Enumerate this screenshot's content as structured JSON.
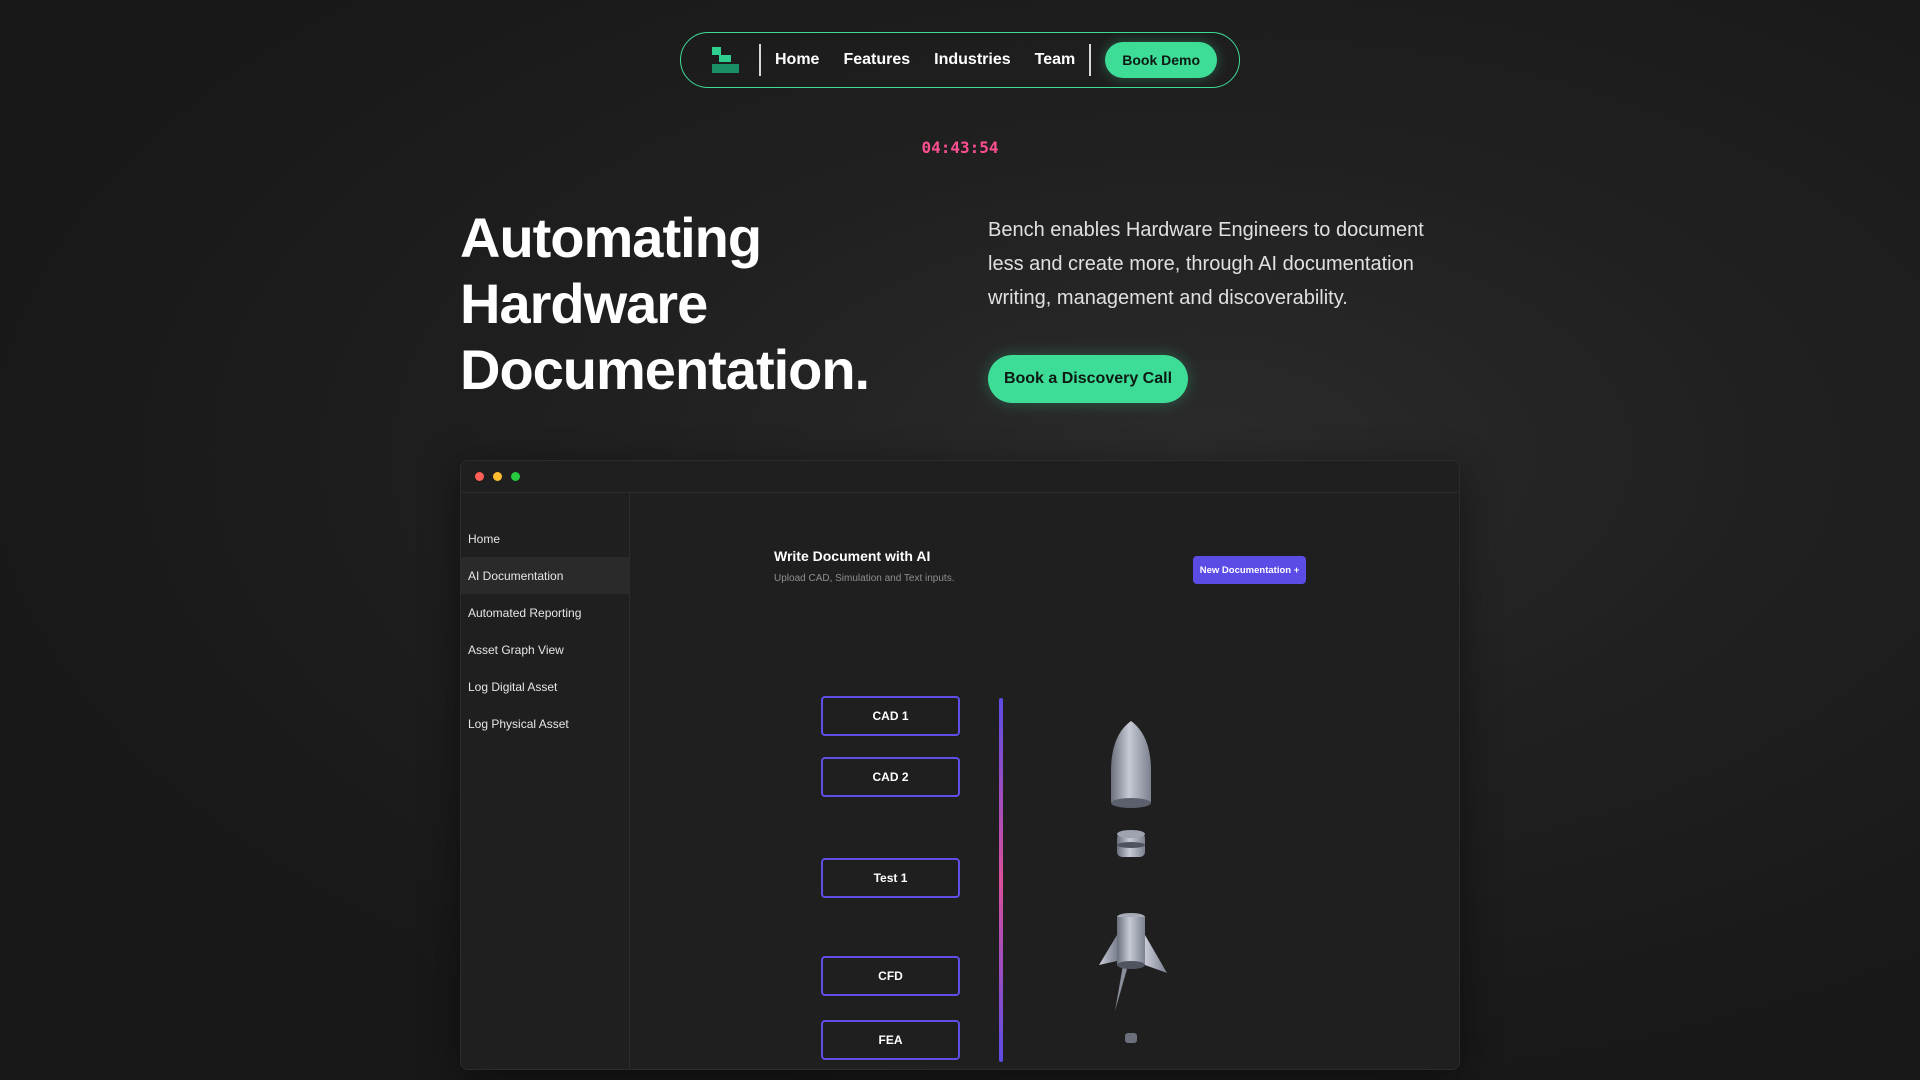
{
  "nav": {
    "links": [
      "Home",
      "Features",
      "Industries",
      "Team"
    ],
    "cta": "Book Demo",
    "logo_icon": "bench-logo-icon"
  },
  "clock": "04:43:54",
  "hero": {
    "title_lines": [
      "Automating",
      "Hardware",
      "Documentation."
    ],
    "description": "Bench enables Hardware Engineers to document less and create more, through AI documentation writing, management and discoverability.",
    "cta": "Book a Discovery Call"
  },
  "app": {
    "sidebar": [
      "Home",
      "AI Documentation",
      "Automated Reporting",
      "Asset Graph View",
      "Log Digital Asset",
      "Log Physical Asset"
    ],
    "active_sidebar": "AI Documentation",
    "main": {
      "title": "Write Document with AI",
      "subtitle": "Upload CAD, Simulation and Text inputs.",
      "new_button": "New Documentation +"
    },
    "inputs": [
      "CAD 1",
      "CAD 2",
      "Test 1",
      "CFD",
      "FEA"
    ],
    "illustration": "rocket-parts-icon"
  },
  "colors": {
    "accent_green": "#3ddc97",
    "accent_purple": "#5b4ce6",
    "accent_pink": "#ff4f93",
    "background": "#1b1b1b"
  }
}
